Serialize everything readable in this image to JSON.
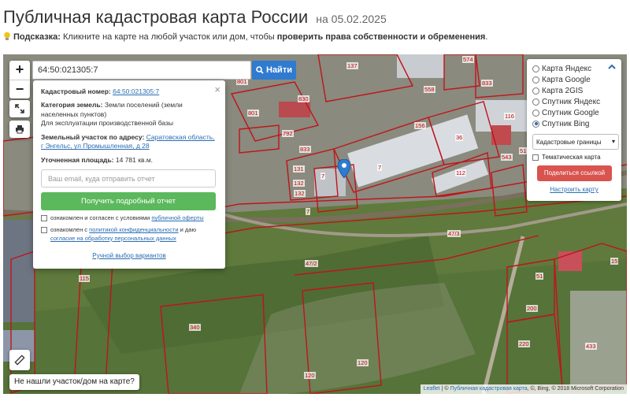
{
  "header": {
    "title": "Публичная кадастровая карта России",
    "date": "на 05.02.2025",
    "hint_label": "Подсказка:",
    "hint_text": " Кликните на карте на любой участок или дом, чтобы ",
    "hint_bold": "проверить права собственности и обременения",
    "hint_end": "."
  },
  "map": {
    "zoom_in": "+",
    "zoom_out": "−",
    "search_value": "64:50:021305:7",
    "search_button": "Найти",
    "not_found": "Не нашли участок/дом на карте?",
    "attribution_leaflet": "Leaflet",
    "attribution_sep": " | © ",
    "attribution_link": "Публичная кадастровая карта",
    "attribution_rest": ", ©, Bing, © 2018 Microsoft Corporation",
    "plot_labels": [
      "137",
      "574",
      "558",
      "833",
      "830",
      "801",
      "792",
      "833",
      "156",
      "116",
      "36",
      "543",
      "51",
      "131",
      "7",
      "132",
      "132",
      "7",
      "112",
      "7",
      "47/3",
      "47/2",
      "115",
      "340",
      "120",
      "120",
      "200",
      "220",
      "433",
      "51",
      "15",
      "801"
    ]
  },
  "popup": {
    "cadastral_label": "Кадастровый номер:",
    "cadastral_value": "64:50:021305:7",
    "category_label": "Категория земель:",
    "category_value": "Земли поселений (земли населенных пунктов)",
    "usage": "Для эксплуатации производственной базы",
    "address_label": "Земельный участок по адресу:",
    "address_value": "Саратовская область, г Энгельс, ул Промышленная, д 28",
    "area_label": "Уточненная площадь:",
    "area_value": "14 781 кв.м.",
    "email_placeholder": "Ваш email, куда отправить отчет",
    "report_button": "Получить подробный отчет",
    "agree1_text": "ознакомлен и согласен с условиями ",
    "agree1_link": "публичной оферты",
    "agree2_text": "ознакомлен с ",
    "agree2_link1": "политикой конфиденциальности",
    "agree2_mid": " и даю ",
    "agree2_link2": "согласие на обработку персональных данных",
    "manual_link": "Ручной выбор вариантов",
    "close": "×"
  },
  "layers": {
    "options": [
      {
        "label": "Карта Яндекс",
        "selected": false
      },
      {
        "label": "Карта Google",
        "selected": false
      },
      {
        "label": "Карта 2GIS",
        "selected": false
      },
      {
        "label": "Спутник Яндекс",
        "selected": false
      },
      {
        "label": "Спутник Google",
        "selected": false
      },
      {
        "label": "Спутник Bing",
        "selected": true
      }
    ],
    "select_value": "Кадастровые границы",
    "thematic_label": "Тематическая карта",
    "share_button": "Поделиться ссылкой",
    "setup_link": "Настроить карту"
  },
  "colors": {
    "accent": "#2f7bd1",
    "report": "#5cb85c",
    "share": "#d9534f",
    "plot_border": "#c0141a"
  }
}
